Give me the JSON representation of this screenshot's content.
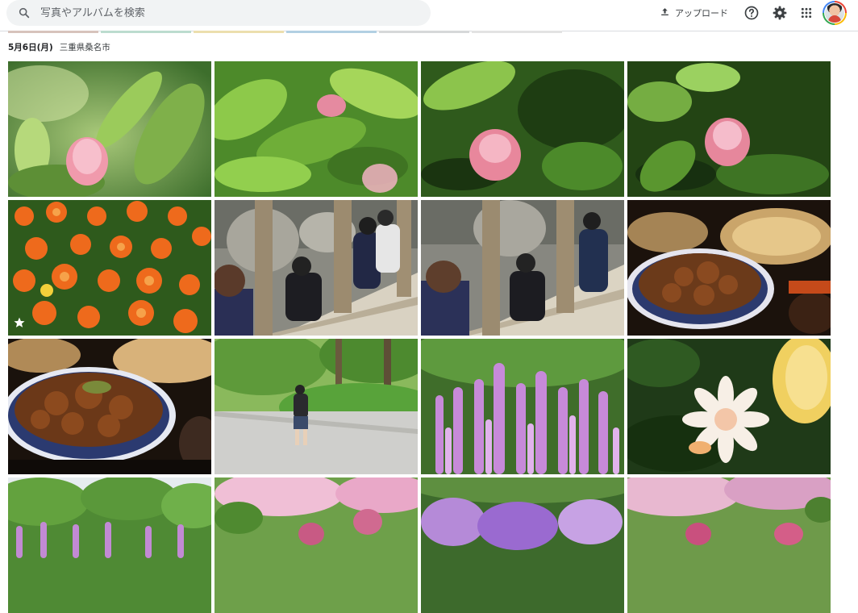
{
  "search": {
    "placeholder": "写真やアルバムを検索"
  },
  "header": {
    "upload_label": "アップロード",
    "icons": [
      "search-icon",
      "upload-icon",
      "help-icon",
      "settings-icon",
      "apps-icon",
      "avatar"
    ]
  },
  "group": {
    "date": "5月6日(月)",
    "location": "三重県桑名市"
  },
  "colors": {
    "accent": "#1a73e8",
    "strip": [
      "#c9b3a8",
      "#b7d4c6",
      "#e8d9a7",
      "#a9c8df",
      "#cfd2d4",
      "#d9d9d9"
    ]
  },
  "photos": [
    {
      "subject": "pink camellia bud among green leaves",
      "favorite": false
    },
    {
      "subject": "pink camellia in bright green foliage",
      "favorite": false
    },
    {
      "subject": "pink camellia close-up",
      "favorite": false
    },
    {
      "subject": "pink camellia on dark green",
      "favorite": false
    },
    {
      "subject": "orange flowers bed",
      "favorite": true
    },
    {
      "subject": "people sitting on wooden bench by rocks",
      "favorite": false
    },
    {
      "subject": "people sitting on wooden bench by rocks 2",
      "favorite": false
    },
    {
      "subject": "bowl of food on table",
      "favorite": false
    },
    {
      "subject": "rice bowl close-up",
      "favorite": false
    },
    {
      "subject": "child walking in park",
      "favorite": false
    },
    {
      "subject": "purple foxglove flowers",
      "favorite": false
    },
    {
      "subject": "white and peach dahlia",
      "favorite": false
    },
    {
      "subject": "green trees with purple flowers",
      "favorite": false
    },
    {
      "subject": "pink peonies blurred",
      "favorite": false
    },
    {
      "subject": "purple flowers blurred",
      "favorite": false
    },
    {
      "subject": "pink flowers blurred",
      "favorite": false
    }
  ]
}
